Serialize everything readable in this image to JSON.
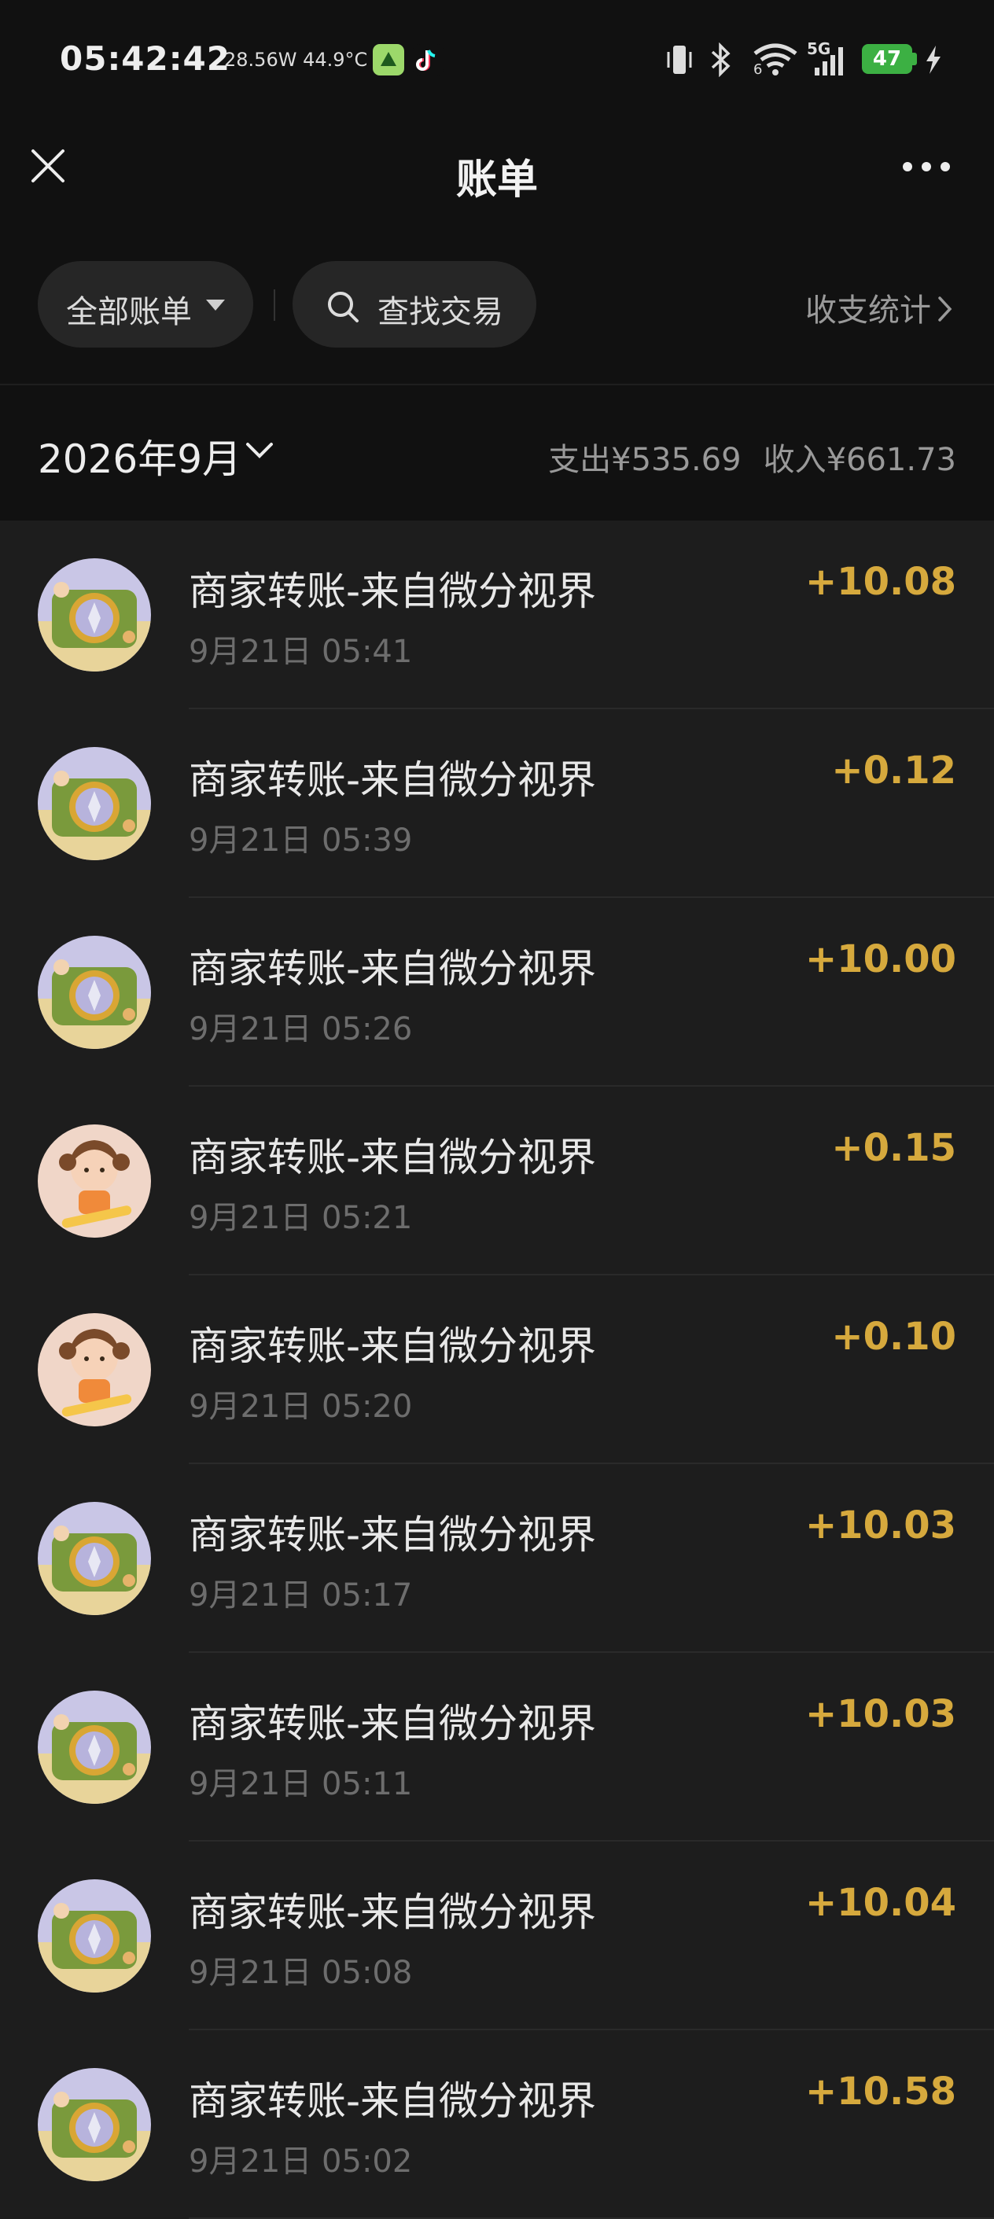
{
  "status_bar": {
    "time": "05:42:42",
    "info": "28.56W 44.9°C",
    "network": "5G",
    "signal_sub": "6",
    "battery": "47"
  },
  "nav": {
    "title": "账单",
    "close_icon": "close-icon",
    "more_icon": "more-icon"
  },
  "filters": {
    "all_bills": "全部账单",
    "search": "查找交易",
    "stats": "收支统计"
  },
  "month": {
    "label": "2026年9月",
    "expense": "支出¥535.69",
    "income": "收入¥661.73"
  },
  "colors": {
    "background": "#1d1d1d",
    "header_background": "#111111",
    "amount": "#d6a93d"
  },
  "transactions": [
    {
      "title": "商家转账-来自微分视界",
      "time": "9月21日 05:41",
      "amount": "+10.08",
      "avatar": "compass"
    },
    {
      "title": "商家转账-来自微分视界",
      "time": "9月21日 05:39",
      "amount": "+0.12",
      "avatar": "compass"
    },
    {
      "title": "商家转账-来自微分视界",
      "time": "9月21日 05:26",
      "amount": "+10.00",
      "avatar": "compass"
    },
    {
      "title": "商家转账-来自微分视界",
      "time": "9月21日 05:21",
      "amount": "+0.15",
      "avatar": "girl"
    },
    {
      "title": "商家转账-来自微分视界",
      "time": "9月21日 05:20",
      "amount": "+0.10",
      "avatar": "girl"
    },
    {
      "title": "商家转账-来自微分视界",
      "time": "9月21日 05:17",
      "amount": "+10.03",
      "avatar": "compass"
    },
    {
      "title": "商家转账-来自微分视界",
      "time": "9月21日 05:11",
      "amount": "+10.03",
      "avatar": "compass"
    },
    {
      "title": "商家转账-来自微分视界",
      "time": "9月21日 05:08",
      "amount": "+10.04",
      "avatar": "compass"
    },
    {
      "title": "商家转账-来自微分视界",
      "time": "9月21日 05:02",
      "amount": "+10.58",
      "avatar": "compass"
    }
  ]
}
